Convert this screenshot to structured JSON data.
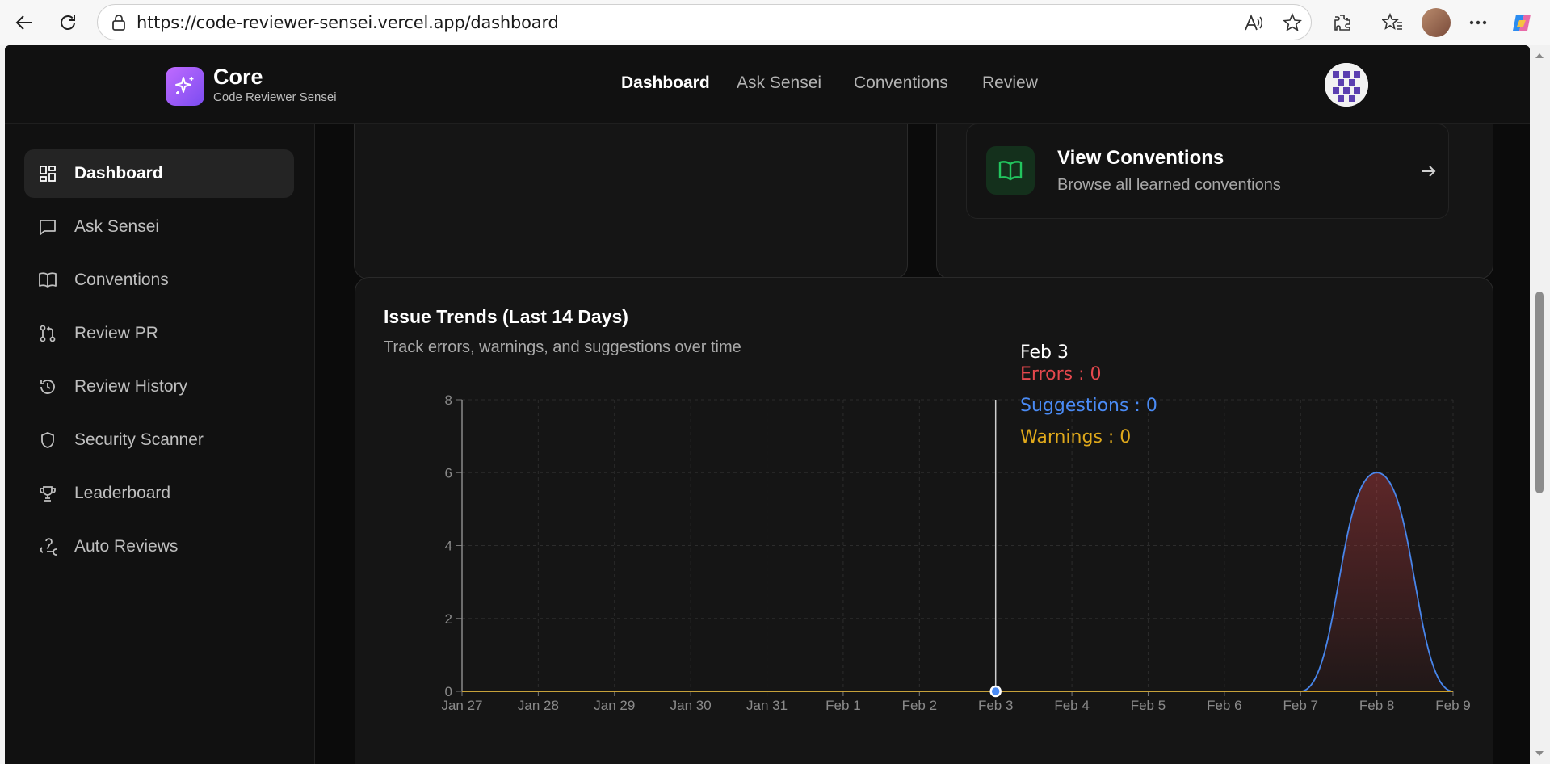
{
  "browser": {
    "url": "https://code-reviewer-sensei.vercel.app/dashboard"
  },
  "app": {
    "brand": "Core",
    "brand_sub": "Code Reviewer Sensei",
    "topnav": [
      "Dashboard",
      "Ask Sensei",
      "Conventions",
      "Review"
    ],
    "active_topnav": "Dashboard"
  },
  "sidebar": {
    "items": [
      {
        "label": "Dashboard",
        "icon": "grid-icon",
        "active": true
      },
      {
        "label": "Ask Sensei",
        "icon": "message-icon"
      },
      {
        "label": "Conventions",
        "icon": "book-icon"
      },
      {
        "label": "Review PR",
        "icon": "git-pull-request-icon"
      },
      {
        "label": "Review History",
        "icon": "history-icon"
      },
      {
        "label": "Security Scanner",
        "icon": "shield-icon"
      },
      {
        "label": "Leaderboard",
        "icon": "trophy-icon"
      },
      {
        "label": "Auto Reviews",
        "icon": "webhook-icon"
      }
    ]
  },
  "conventions_tile": {
    "title": "View Conventions",
    "subtitle": "Browse all learned conventions"
  },
  "issue_trends": {
    "title": "Issue Trends (Last 14 Days)",
    "subtitle": "Track errors, warnings, and suggestions over time",
    "tooltip": {
      "date": "Feb 3",
      "errors": "Errors : 0",
      "suggestions": "Suggestions : 0",
      "warnings": "Warnings : 0"
    }
  },
  "colors": {
    "errors": "#e5484d",
    "suggestions": "#4a8bf5",
    "warnings": "#e0a91b"
  },
  "chart_data": {
    "type": "area",
    "title": "Issue Trends (Last 14 Days)",
    "x": [
      "Jan 27",
      "Jan 28",
      "Jan 29",
      "Jan 30",
      "Jan 31",
      "Feb 1",
      "Feb 2",
      "Feb 3",
      "Feb 4",
      "Feb 5",
      "Feb 6",
      "Feb 7",
      "Feb 8",
      "Feb 9"
    ],
    "yticks": [
      "0",
      "2",
      "4",
      "6",
      "8"
    ],
    "ylim": [
      0,
      8
    ],
    "grid": true,
    "series": [
      {
        "name": "Errors",
        "color": "#e5484d",
        "values": [
          0,
          0,
          0,
          0,
          0,
          0,
          0,
          0,
          0,
          0,
          0,
          0,
          6,
          0
        ]
      },
      {
        "name": "Suggestions",
        "color": "#4a8bf5",
        "values": [
          0,
          0,
          0,
          0,
          0,
          0,
          0,
          0,
          0,
          0,
          0,
          0,
          6,
          0
        ]
      },
      {
        "name": "Warnings",
        "color": "#e0a91b",
        "values": [
          0,
          0,
          0,
          0,
          0,
          0,
          0,
          0,
          0,
          0,
          0,
          0,
          0,
          0
        ]
      }
    ],
    "highlight_index": 7
  }
}
